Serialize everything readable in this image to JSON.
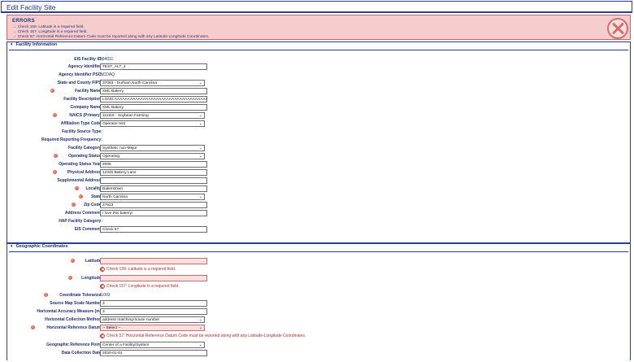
{
  "page": {
    "title": "Edit Facility Site"
  },
  "errors": {
    "heading": "Errors",
    "messages": [
      "Check 156: Latitude is a required field.",
      "Check 157: Longitude is a required field.",
      "Check 57: Horizontal Reference Datum Code must be reported along with any Latitude-Longitude Coordinates."
    ]
  },
  "facility_info": {
    "heading": "Facility Information",
    "fields": {
      "eis_facility_id": {
        "label": "EIS Facility ID:",
        "value": "594011"
      },
      "agency_identifier": {
        "label": "Agency Identifier:",
        "value": "TEST_ALT_4"
      },
      "agency_identifier_psc": {
        "label": "Agency Identifier PSC:",
        "value": "NCDAQ"
      },
      "state_county_fips": {
        "label": "State and County FIPS:",
        "value": "37063 - Durham,North Carolina"
      },
      "facility_name": {
        "label": "Facility Name:",
        "value": "XML Bakery"
      },
      "facility_description": {
        "label": "Facility Description:",
        "value": "LONG AAAAAAAAAAAAAAAAAAAAAAAAAAAAAAAAAAAA"
      },
      "company_name": {
        "label": "Company Name:",
        "value": "XML Bakery"
      },
      "naics_primary": {
        "label": "NAICS (Primary):",
        "value": "111110 - Soybean Farming"
      },
      "affiliation_type_code": {
        "label": "Affiliation Type Code:",
        "value": "Operator test"
      },
      "facility_source_type": {
        "label": "Facility Source Type:",
        "value": ""
      },
      "required_reporting_frequency": {
        "label": "Required Reporting Frequency:",
        "value": ""
      },
      "facility_category": {
        "label": "Facility Category:",
        "value": "Synthetic non-Major"
      },
      "operating_status": {
        "label": "Operating Status:",
        "value": "Operating"
      },
      "operating_status_year": {
        "label": "Operating Status Year:",
        "value": "2006"
      },
      "physical_address": {
        "label": "Physical Address:",
        "value": "12345 Bakery Lane"
      },
      "supplemental_address": {
        "label": "Supplemental Address:",
        "value": ""
      },
      "locality": {
        "label": "Locality:",
        "value": "Bakerstown"
      },
      "state": {
        "label": "State:",
        "value": "North Carolina"
      },
      "zip_code": {
        "label": "Zip Code:",
        "value": "27613"
      },
      "address_comment": {
        "label": "Address Comment:",
        "value": "I love this bakery!"
      },
      "hap_facility_category": {
        "label": "HAP Facility Category:",
        "value": ""
      },
      "eis_comment": {
        "label": "EIS Comment:",
        "value": "Check 57"
      }
    }
  },
  "geo": {
    "heading": "Geographic Coordinates",
    "fields": {
      "latitude": {
        "label": "Latitude:",
        "value": "",
        "error": "Check 156: Latitude is a required field."
      },
      "longitude": {
        "label": "Longitude:",
        "value": "",
        "error": "Check 157: Longitude is a required field."
      },
      "coordinate_tolerance": {
        "label": "Coordinate Tolerance:",
        "value": "0.003"
      },
      "source_map_scale_number": {
        "label": "Source Map Scale Number:",
        "value": "3"
      },
      "horizontal_accuracy_measure": {
        "label": "Horizontal Accuracy Measure (m):",
        "value": "3"
      },
      "horizontal_collection_method": {
        "label": "Horizontal Collection Method:",
        "value": "address matching-house number"
      },
      "horizontal_reference_datum": {
        "label": "Horizontal Reference Datum:",
        "value": "-- Select --",
        "error": "Check 57: Horizontal Reference Datum Code must be reported along with any Latitude-Longitude Coordinates."
      },
      "geographic_reference_point": {
        "label": "Geographic Reference Point:",
        "value": "Center of a Facility/System"
      },
      "data_collection_date": {
        "label": "Data Collection Date:",
        "value": "2020-01-01"
      }
    }
  },
  "colors": {
    "accent": "#2b3f8c",
    "error_bg": "#f6cccc",
    "error_text": "#a8322a",
    "required_dot": "#c9382a"
  },
  "icons": {
    "collapse": "triangle-down-icon",
    "required": "required-dot-icon",
    "error": "error-x-icon",
    "close": "close-icon"
  }
}
